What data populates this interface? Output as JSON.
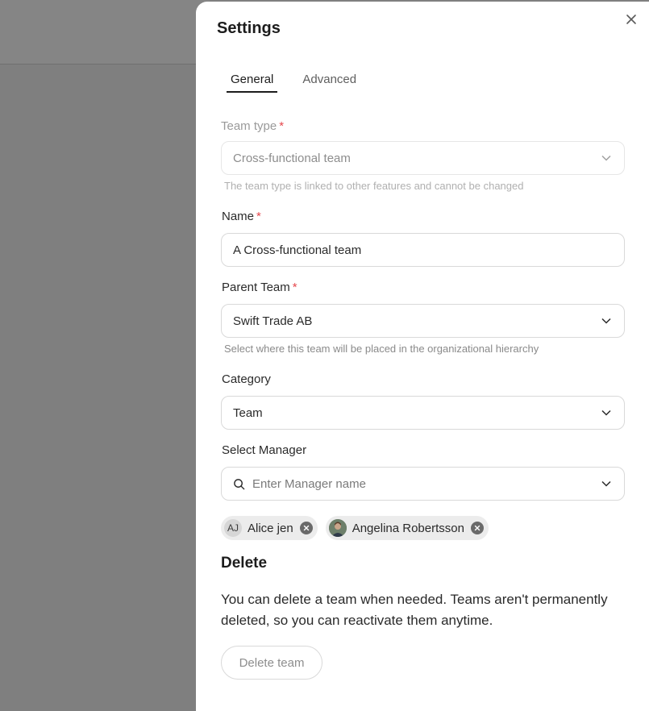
{
  "dialog": {
    "title": "Settings",
    "tabs": [
      {
        "label": "General",
        "active": true
      },
      {
        "label": "Advanced",
        "active": false
      }
    ]
  },
  "form": {
    "team_type": {
      "label": "Team type",
      "required_mark": "*",
      "value": "Cross-functional team",
      "hint": "The team type is linked to other features and cannot be changed",
      "disabled": true
    },
    "name": {
      "label": "Name",
      "required_mark": "*",
      "value": "A Cross-functional team"
    },
    "parent_team": {
      "label": "Parent Team",
      "required_mark": "*",
      "value": "Swift Trade AB",
      "hint": "Select where this team will be placed in the organizational hierarchy"
    },
    "category": {
      "label": "Category",
      "value": "Team"
    },
    "manager": {
      "label": "Select Manager",
      "placeholder": "Enter Manager name",
      "selected": [
        {
          "initials": "AJ",
          "name": "Alice jen",
          "avatar": "initials"
        },
        {
          "initials": "",
          "name": "Angelina Robertsson",
          "avatar": "photo"
        }
      ]
    }
  },
  "delete_section": {
    "title": "Delete",
    "description": "You can delete a team when needed. Teams aren't permanently deleted, so you can reactivate them anytime.",
    "button_label": "Delete team"
  },
  "colors": {
    "required": "#e5484d",
    "backdrop": "#7f7f7f",
    "panel": "#ffffff"
  }
}
